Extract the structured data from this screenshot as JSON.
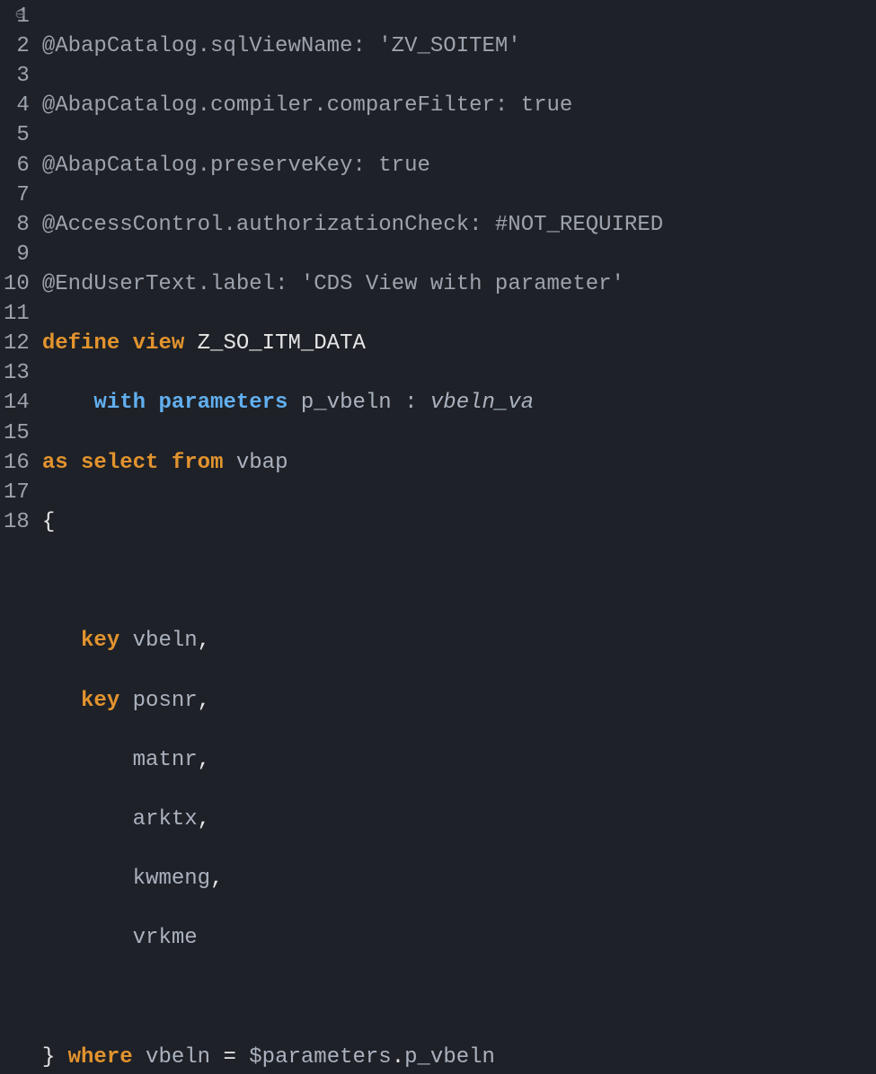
{
  "gutter": [
    "1",
    "2",
    "3",
    "4",
    "5",
    "6",
    "7",
    "8",
    "9",
    "10",
    "11",
    "12",
    "13",
    "14",
    "15",
    "16",
    "17",
    "18"
  ],
  "lines": {
    "l1a": "@AbapCatalog.sqlViewName",
    "l1b": ": ",
    "l1c": "'ZV_SOITEM'",
    "l2a": "@AbapCatalog.compiler.compareFilter",
    "l2b": ": ",
    "l2c": "true",
    "l3a": "@AbapCatalog.preserveKey",
    "l3b": ": ",
    "l3c": "true",
    "l4a": "@AccessControl.authorizationCheck",
    "l4b": ": ",
    "l4c": "#NOT_REQUIRED",
    "l5a": "@EndUserText.label",
    "l5b": ": ",
    "l5c": "'CDS View with parameter'",
    "l6a": "define",
    "l6b": " ",
    "l6c": "view",
    "l6d": " ",
    "l6e": "Z_SO_ITM_DATA",
    "l7pad": "    ",
    "l7a": "with",
    "l7b": " ",
    "l7c": "parameters",
    "l7d": " p_vbeln ",
    "l7e": ":",
    "l7f": " ",
    "l7g": "vbeln_va",
    "l8a": "as",
    "l8b": " ",
    "l8c": "select",
    "l8d": " ",
    "l8e": "from",
    "l8f": " vbap",
    "l9a": "{",
    "l10a": "",
    "l11pad": "   ",
    "l11a": "key",
    "l11b": " vbeln",
    "l11c": ",",
    "l12pad": "   ",
    "l12a": "key",
    "l12b": " posnr",
    "l12c": ",",
    "l13pad": "       ",
    "l13a": "matnr",
    "l13b": ",",
    "l14pad": "       ",
    "l14a": "arktx",
    "l14b": ",",
    "l15pad": "       ",
    "l15a": "kwmeng",
    "l15b": ",",
    "l16pad": "       ",
    "l16a": "vrkme",
    "l17a": "",
    "l18a": "}",
    "l18b": " ",
    "l18c": "where",
    "l18d": " vbeln ",
    "l18e": "=",
    "l18f": " $parameters",
    "l18g": ".",
    "l18h": "p_vbeln"
  }
}
